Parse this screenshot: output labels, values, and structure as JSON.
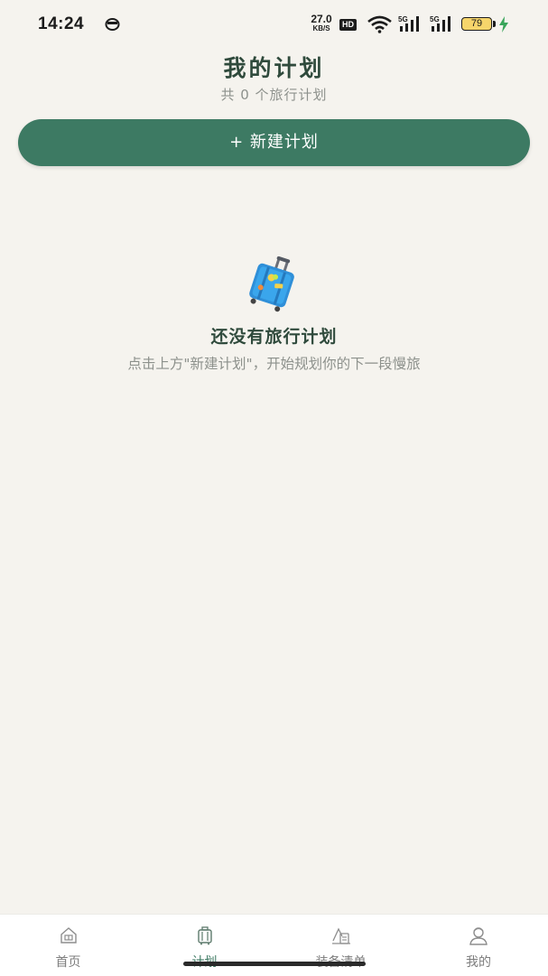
{
  "status_bar": {
    "time": "14:24",
    "net_speed_value": "27.0",
    "net_speed_unit": "KB/S",
    "hd_label": "HD",
    "signal1_label": "5G",
    "signal2_label": "5G",
    "battery_level": "79",
    "battery_color": "#f6d56b",
    "charging_color": "#3aa55b"
  },
  "header": {
    "title": "我的计划",
    "subtitle": "共 0 个旅行计划"
  },
  "new_plan_button": {
    "label": "+ 新建计划",
    "color": "#3d7a63"
  },
  "empty_state": {
    "icon": "suitcase-icon",
    "title": "还没有旅行计划",
    "hint": "点击上方\"新建计划\"，开始规划你的下一段慢旅"
  },
  "tab_bar": {
    "active_color": "#3d7a63",
    "tabs": [
      {
        "label": "首页",
        "icon": "home-icon"
      },
      {
        "label": "计划",
        "icon": "suitcase-icon"
      },
      {
        "label": "装备清单",
        "icon": "checklist-icon"
      },
      {
        "label": "我的",
        "icon": "profile-icon"
      }
    ]
  }
}
